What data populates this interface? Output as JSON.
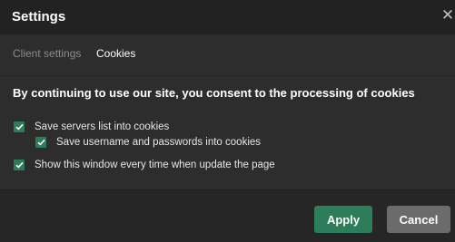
{
  "dialog": {
    "title": "Settings",
    "close_glyph": "✕"
  },
  "tabs": [
    {
      "label": "Client settings",
      "active": false
    },
    {
      "label": "Cookies",
      "active": true
    }
  ],
  "cookies": {
    "heading": "By continuing to use our site, you consent to the processing of cookies",
    "options": [
      {
        "label": "Save servers list into cookies",
        "checked": true
      },
      {
        "label": "Save username and passwords into cookies",
        "checked": true
      },
      {
        "label": "Show this window every time when update the page",
        "checked": true
      }
    ]
  },
  "footer": {
    "apply_label": "Apply",
    "cancel_label": "Cancel"
  },
  "colors": {
    "accent": "#2e7d5a",
    "cancel": "#6b6b6b",
    "background": "#2d2d2d",
    "titlebar": "#222222"
  }
}
